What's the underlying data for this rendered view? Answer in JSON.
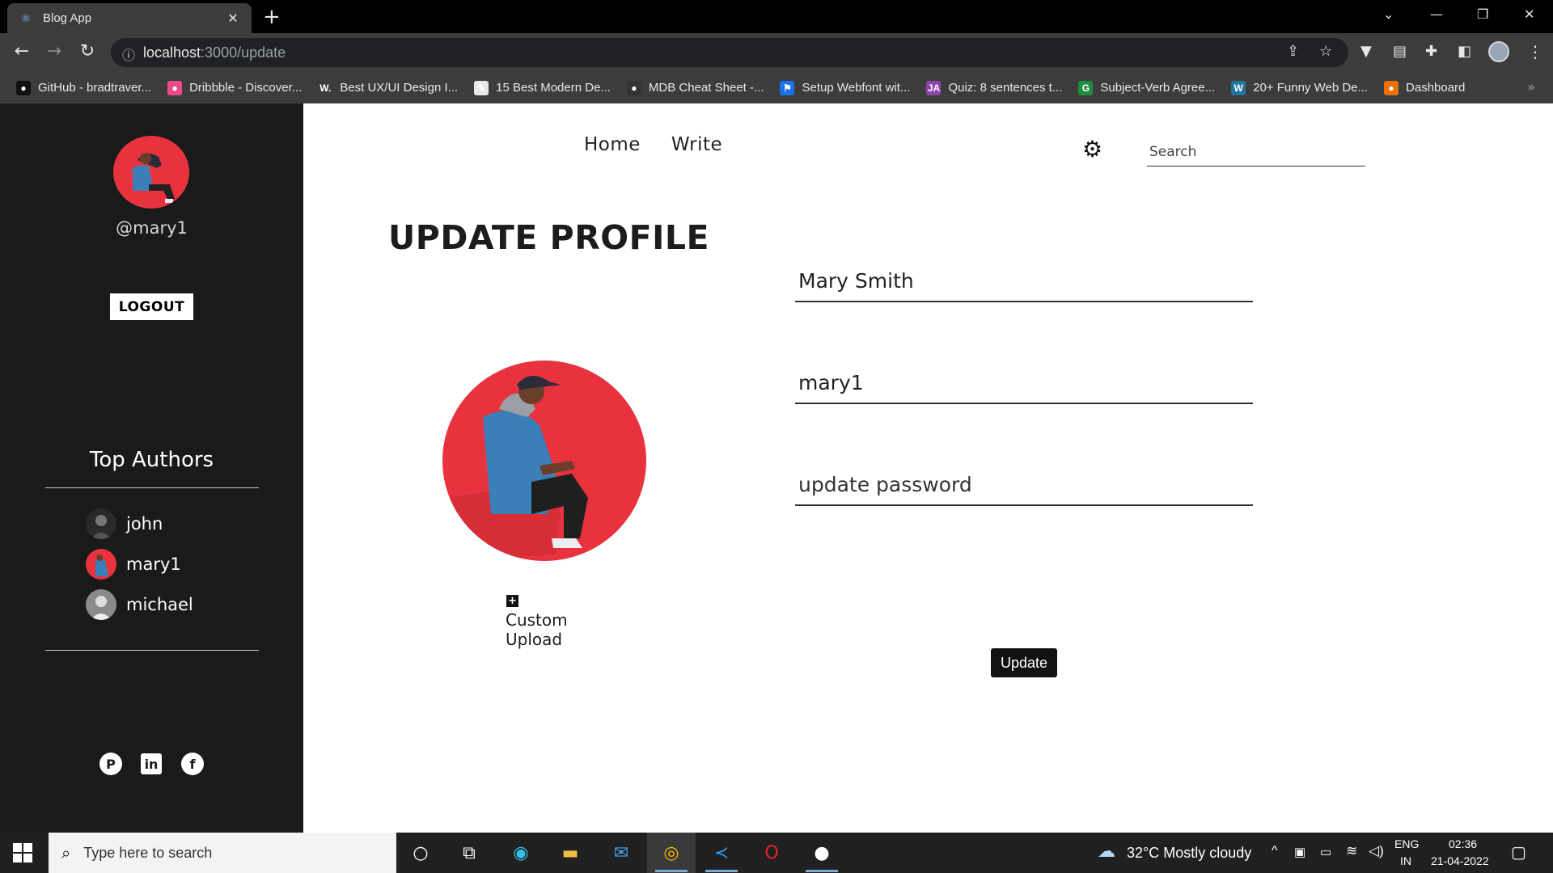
{
  "browser": {
    "tab_title": "Blog App",
    "tab_close": "✕",
    "new_tab": "+",
    "url_host": "localhost",
    "url_path": ":3000/update",
    "bookmarks": [
      {
        "label": "GitHub - bradtraver...",
        "color": "#111111",
        "glyph": "●"
      },
      {
        "label": "Dribbble - Discover...",
        "color": "#ea4c89",
        "glyph": "●"
      },
      {
        "label": "Best UX/UI Design I...",
        "color": "#3c3c3c",
        "glyph": "W."
      },
      {
        "label": "15 Best Modern De...",
        "color": "#e8e8e8",
        "glyph": "✎"
      },
      {
        "label": "MDB Cheat Sheet -...",
        "color": "#333333",
        "glyph": "●"
      },
      {
        "label": "Setup Webfont wit...",
        "color": "#1a73e8",
        "glyph": "⚑"
      },
      {
        "label": "Quiz: 8 sentences t...",
        "color": "#8e44ad",
        "glyph": "JA"
      },
      {
        "label": "Subject-Verb Agree...",
        "color": "#1e8e3e",
        "glyph": "G"
      },
      {
        "label": "20+ Funny Web De...",
        "color": "#21759b",
        "glyph": "W"
      },
      {
        "label": "Dashboard",
        "color": "#e8710a",
        "glyph": "●"
      }
    ],
    "bookmarks_more": "»"
  },
  "sidebar": {
    "username": "@mary1",
    "logout_label": "LOGOUT",
    "top_authors_heading": "Top Authors",
    "authors": [
      {
        "name": "john",
        "avatar_color": "#2a2a2a"
      },
      {
        "name": "mary1",
        "avatar_color": "#e8333f"
      },
      {
        "name": "michael",
        "avatar_color": "#555555"
      }
    ],
    "social": [
      "pinterest-icon",
      "linkedin-icon",
      "facebook-icon"
    ]
  },
  "topnav": {
    "home": "Home",
    "write": "Write",
    "search_placeholder": "Search"
  },
  "main": {
    "title": "UPDATE PROFILE",
    "upload_label": "Custom Upload",
    "name_value": "Mary Smith",
    "username_value": "mary1",
    "password_placeholder": "update password",
    "update_label": "Update"
  },
  "taskbar": {
    "search_placeholder": "Type here to search",
    "weather": "32°C  Mostly cloudy",
    "lang_1": "ENG",
    "lang_2": "IN",
    "time": "02:36",
    "date": "21-04-2022"
  },
  "colors": {
    "accent_red": "#e8333f",
    "sidebar_bg": "#1a1a1a",
    "chrome_bg": "#3c3c3c"
  }
}
